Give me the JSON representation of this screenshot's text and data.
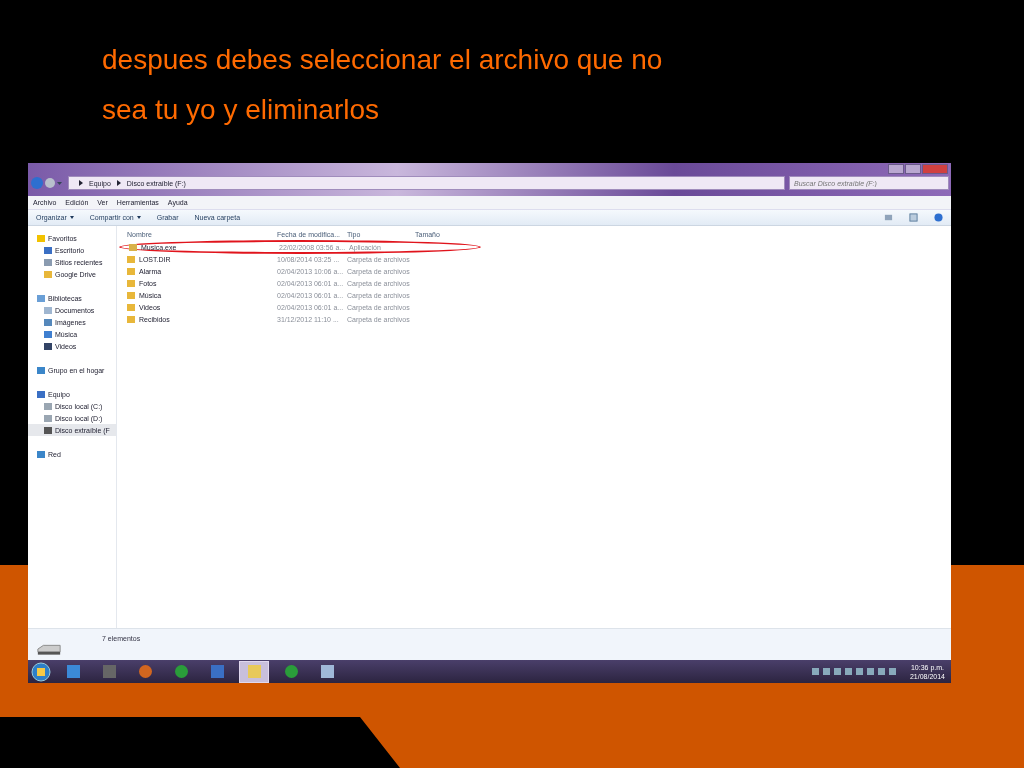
{
  "slide": {
    "title": "despues debes seleccionar  el archivo que no sea tu yo y eliminarlos"
  },
  "window": {
    "breadcrumb": [
      "Equipo",
      "Disco extraíble (F:)"
    ],
    "search": {
      "placeholder": "Buscar Disco extraíble (F:)"
    },
    "menu": [
      "Archivo",
      "Edición",
      "Ver",
      "Herramientas",
      "Ayuda"
    ],
    "toolbar": [
      {
        "label": "Organizar",
        "dropdown": true
      },
      {
        "label": "Compartir con",
        "dropdown": true
      },
      {
        "label": "Grabar",
        "dropdown": false
      },
      {
        "label": "Nueva carpeta",
        "dropdown": false
      }
    ],
    "sidebar": [
      {
        "label": "Favoritos",
        "kind": "star",
        "selected": false,
        "children": [
          {
            "label": "Escritorio",
            "kind": "desktop",
            "selected": false
          },
          {
            "label": "Sitios recientes",
            "kind": "recent",
            "selected": false
          },
          {
            "label": "Google Drive",
            "kind": "folder",
            "selected": false
          }
        ]
      },
      {
        "label": "Bibliotecas",
        "kind": "library",
        "selected": false,
        "children": [
          {
            "label": "Documentos",
            "kind": "doc",
            "selected": false
          },
          {
            "label": "Imágenes",
            "kind": "image",
            "selected": false
          },
          {
            "label": "Música",
            "kind": "music",
            "selected": false
          },
          {
            "label": "Videos",
            "kind": "video",
            "selected": false
          }
        ]
      },
      {
        "label": "Grupo en el hogar",
        "kind": "group",
        "selected": false
      },
      {
        "label": "Equipo",
        "kind": "computer",
        "selected": false,
        "children": [
          {
            "label": "Disco local (C:)",
            "kind": "drive",
            "selected": false
          },
          {
            "label": "Disco local (D:)",
            "kind": "drive",
            "selected": false
          },
          {
            "label": "Disco extraíble (F",
            "kind": "usb",
            "selected": true
          }
        ]
      },
      {
        "label": "Red",
        "kind": "network",
        "selected": false
      }
    ],
    "columns": [
      "Nombre",
      "Fecha de modifica...",
      "Tipo",
      "Tamaño"
    ],
    "rows": [
      {
        "name": "Musica.exe",
        "date": "22/02/2008 03:56 a...",
        "type": "Aplicación",
        "kind": "app",
        "circled": true
      },
      {
        "name": "LOST.DIR",
        "date": "10/08/2014 03:25 ...",
        "type": "Carpeta de archivos",
        "kind": "folder",
        "circled": false
      },
      {
        "name": "Alarma",
        "date": "02/04/2013 10:06 a...",
        "type": "Carpeta de archivos",
        "kind": "folder",
        "circled": false
      },
      {
        "name": "Fotos",
        "date": "02/04/2013 06:01 a...",
        "type": "Carpeta de archivos",
        "kind": "folder",
        "circled": false
      },
      {
        "name": "Música",
        "date": "02/04/2013 06:01 a...",
        "type": "Carpeta de archivos",
        "kind": "folder",
        "circled": false
      },
      {
        "name": "Videos",
        "date": "02/04/2013 06:01 a...",
        "type": "Carpeta de archivos",
        "kind": "folder",
        "circled": false
      },
      {
        "name": "Recibidos",
        "date": "31/12/2012 11:10 ...",
        "type": "Carpeta de archivos",
        "kind": "folder",
        "circled": false
      }
    ],
    "status": "7 elementos"
  },
  "taskbar": {
    "items": [
      {
        "kind": "media",
        "selected": false
      },
      {
        "kind": "projector",
        "selected": false
      },
      {
        "kind": "hand",
        "selected": false
      },
      {
        "kind": "browser",
        "selected": false
      },
      {
        "kind": "printer",
        "selected": false
      },
      {
        "kind": "folder",
        "selected": true
      },
      {
        "kind": "browser",
        "selected": false
      },
      {
        "kind": "paint",
        "selected": false
      }
    ],
    "time": "10:36 p.m.",
    "date": "21/08/2014"
  }
}
